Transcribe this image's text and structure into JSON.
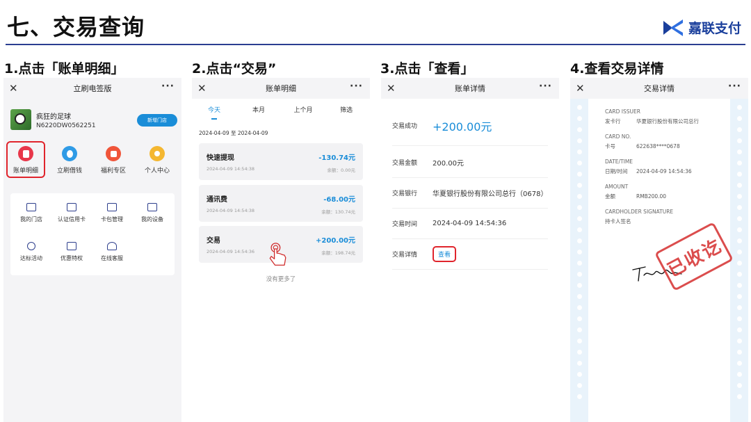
{
  "slide": {
    "title": "七、交易查询",
    "brand": "嘉联支付",
    "steps": [
      "1.点击「账单明细」",
      "2.点击“交易”",
      "3.点击「查看」",
      "4.查看交易详情"
    ]
  },
  "screen1": {
    "topbar_title": "立刷电签版",
    "close_glyph": "✕",
    "more_glyph": "···",
    "merchant_name": "疯狂的足球",
    "merchant_id": "N6220DW0562251",
    "add_store_button": "新增门店",
    "quick_items": [
      {
        "label": "账单明细",
        "color": "#e8374a"
      },
      {
        "label": "立刷借钱",
        "color": "#2f9be6"
      },
      {
        "label": "福利专区",
        "color": "#f0553a"
      },
      {
        "label": "个人中心",
        "color": "#f4b731"
      }
    ],
    "tools": [
      "我的门店",
      "认证信用卡",
      "卡包管理",
      "我的设备",
      "达标活动",
      "优惠特权",
      "在线客服"
    ]
  },
  "screen2": {
    "topbar_title": "账单明细",
    "tabs": [
      "今天",
      "本月",
      "上个月",
      "筛选"
    ],
    "date_range": "2024-04-09 至 2024-04-09",
    "records": [
      {
        "name": "快速提现",
        "amount": "-130.74元",
        "time": "2024-04-09 14:54:38",
        "balance": "余额：0.00元"
      },
      {
        "name": "通讯费",
        "amount": "-68.00元",
        "time": "2024-04-09 14:54:38",
        "balance": "余额：130.74元"
      },
      {
        "name": "交易",
        "amount": "+200.00元",
        "time": "2024-04-09 14:54:36",
        "balance": "余额：198.74元"
      }
    ],
    "no_more": "没有更多了"
  },
  "screen3": {
    "topbar_title": "账单详情",
    "status_label": "交易成功",
    "status_amount": "+200.00元",
    "rows": [
      {
        "key": "交易金额",
        "value": "200.00元"
      },
      {
        "key": "交易银行",
        "value": "华夏银行股份有限公司总行（0678）"
      },
      {
        "key": "交易时间",
        "value": "2024-04-09 14:54:36"
      }
    ],
    "detail_key": "交易详情",
    "detail_link": "查看"
  },
  "screen4": {
    "topbar_title": "交易详情",
    "issuer_en": "CARD ISSUER",
    "issuer_label": "发卡行",
    "issuer_value": "华夏银行股份有限公司总行",
    "card_en": "CARD NO.",
    "card_label": "卡号",
    "card_value": "622638****0678",
    "datetime_en": "DATE/TIME",
    "datetime_label": "日期/时间",
    "datetime_value": "2024-04-09 14:54:36",
    "amount_en": "AMOUNT",
    "amount_label": "金额",
    "amount_value": "RMB200.00",
    "signature_en": "CARDHOLDER SIGNATURE",
    "signature_label": "持卡人签名",
    "stamp_text": "已收讫"
  },
  "colors": {
    "accent_blue": "#1a8dd8",
    "highlight_red": "#e0242c",
    "brand_navy": "#1a3f9c",
    "panel_bg": "#9aa8f2"
  }
}
